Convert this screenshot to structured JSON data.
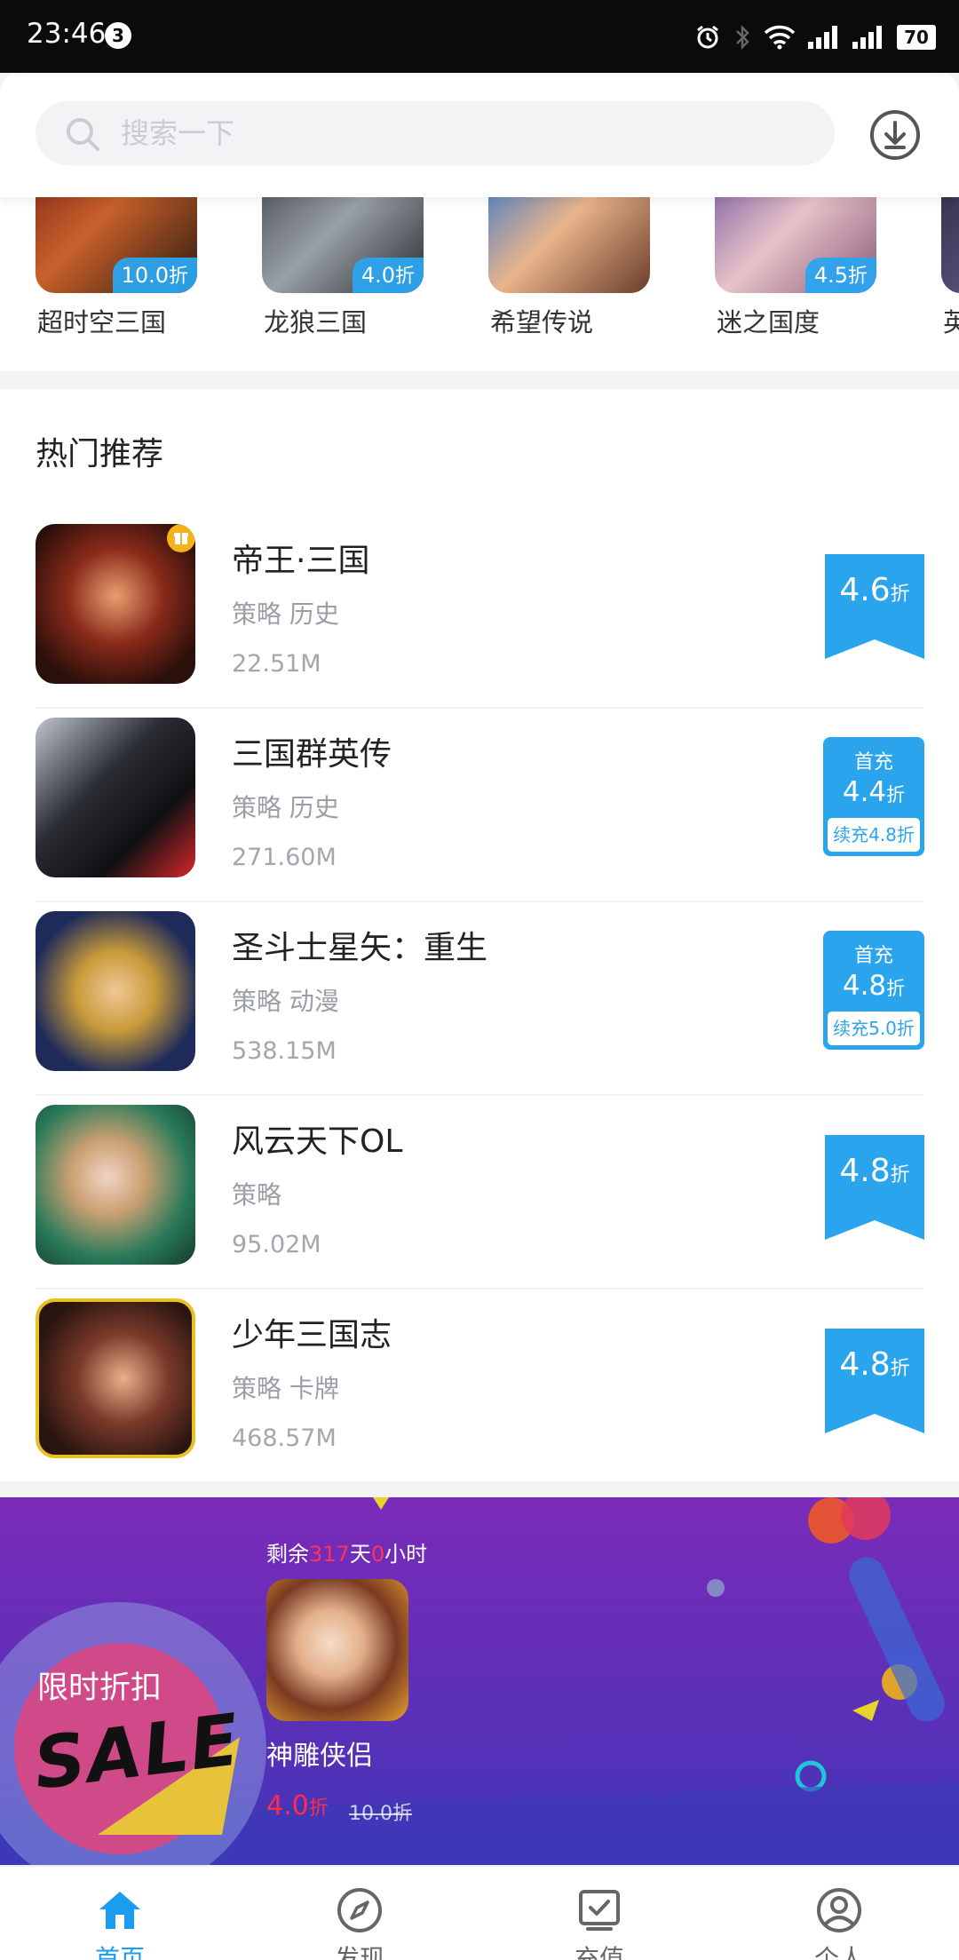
{
  "status_bar": {
    "time": "23:46",
    "notification_count": "3",
    "battery": "70"
  },
  "search": {
    "placeholder": "搜索一下"
  },
  "top_games": [
    {
      "name": "超时空三国",
      "discount": "10.0",
      "unit": "折",
      "has_badge": true
    },
    {
      "name": "龙狼三国",
      "discount": "4.0",
      "unit": "折",
      "has_badge": true
    },
    {
      "name": "希望传说",
      "has_badge": false
    },
    {
      "name": "迷之国度",
      "discount": "4.5",
      "unit": "折",
      "has_badge": true
    },
    {
      "name": "英",
      "has_badge": false
    }
  ],
  "hot_section": {
    "title": "热门推荐",
    "apps": [
      {
        "name": "帝王·三国",
        "tags": "策略 历史",
        "size": "22.51M",
        "discount": "4.6",
        "unit": "折",
        "badge_type": "ribbon",
        "gift_icon": true
      },
      {
        "name": "三国群英传",
        "tags": "策略 历史",
        "size": "271.60M",
        "first_label": "首充",
        "discount": "4.4",
        "unit": "折",
        "renew": "续充4.8折",
        "badge_type": "first-charge"
      },
      {
        "name": "圣斗士星矢：重生",
        "tags": "策略 动漫",
        "size": "538.15M",
        "first_label": "首充",
        "discount": "4.8",
        "unit": "折",
        "renew": "续充5.0折",
        "badge_type": "first-charge"
      },
      {
        "name": "风云天下OL",
        "tags": "策略",
        "size": "95.02M",
        "discount": "4.8",
        "unit": "折",
        "badge_type": "ribbon"
      },
      {
        "name": "少年三国志",
        "tags": "策略 卡牌",
        "size": "468.57M",
        "discount": "4.8",
        "unit": "折",
        "badge_type": "ribbon"
      }
    ]
  },
  "promo": {
    "countdown_prefix": "剩余",
    "countdown_days": "317",
    "countdown_days_unit": "天",
    "countdown_hours": "0",
    "countdown_hours_unit": "小时",
    "label": "限时折扣",
    "sale_text": "SALE",
    "game_name": "神雕侠侣",
    "price": "4.0",
    "price_unit": "折",
    "old_price": "10.0折"
  },
  "bottom_nav": [
    {
      "label": "首页",
      "active": true
    },
    {
      "label": "发现",
      "active": false
    },
    {
      "label": "充值",
      "active": false
    },
    {
      "label": "个人",
      "active": false
    }
  ],
  "colors": {
    "accent": "#2ba4ee",
    "nav_active": "#1a9cf0",
    "promo_price": "#ff2d4a",
    "promo_bg": "#6a2fb8"
  }
}
